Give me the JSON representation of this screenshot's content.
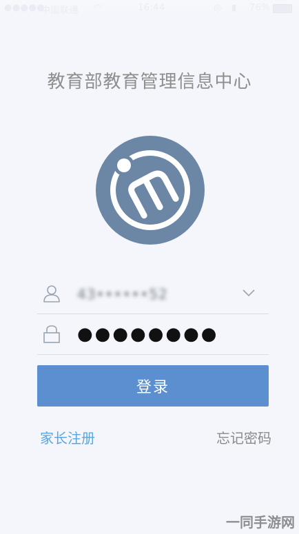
{
  "status_bar": {
    "signal": "●●●●●",
    "carrier": "中国联通",
    "wifi_icon": "wifi-icon",
    "time": "16:44",
    "alarm_icon": "alarm-icon",
    "lock_icon": "lock-icon",
    "battery_percent": "76%",
    "battery_icon": "battery-icon"
  },
  "app": {
    "title": "教育部教育管理信息中心",
    "logo_icon": "app-logo-icon",
    "logo_color": "#6c86a6"
  },
  "form": {
    "username_value": "43••••••52",
    "password_value": "●●●●●●●●",
    "login_label": "登录"
  },
  "links": {
    "register_label": "家长注册",
    "forgot_label": "忘记密码"
  },
  "watermark": "一同手游网",
  "colors": {
    "accent": "#5b8fcf",
    "link": "#5aa6de",
    "background": "#f4f6fb"
  }
}
